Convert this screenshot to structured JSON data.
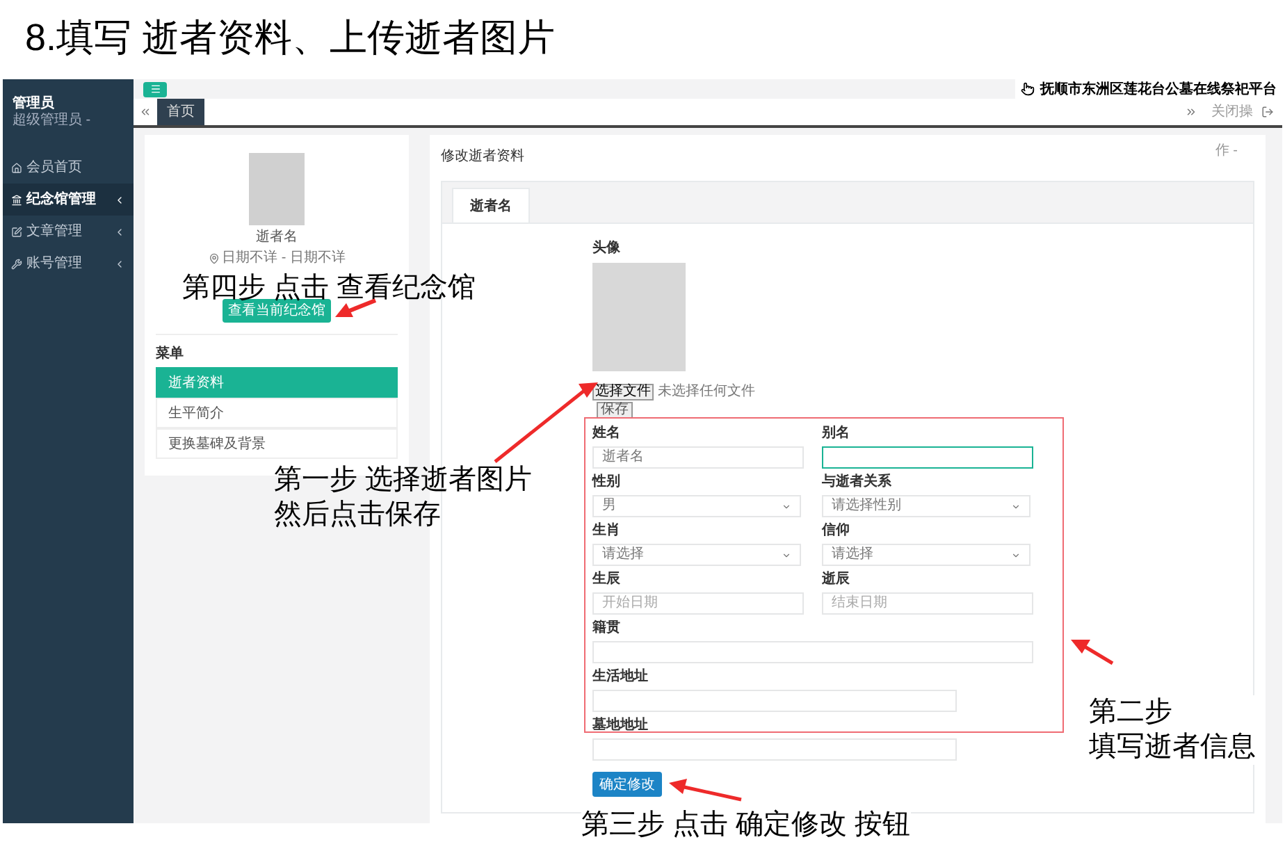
{
  "heading": "8.填写 逝者资料、上传逝者图片",
  "sidebar": {
    "user_name": "管理员",
    "user_role": "超级管理员 -",
    "items": [
      {
        "label": "会员首页",
        "selected": false,
        "has_children": false
      },
      {
        "label": "纪念馆管理",
        "selected": true,
        "has_children": true
      },
      {
        "label": "文章管理",
        "selected": false,
        "has_children": true
      },
      {
        "label": "账号管理",
        "selected": false,
        "has_children": true
      }
    ]
  },
  "topbar": {
    "site_title": "抚顺市东洲区莲花台公墓在线祭祀平台",
    "tabs": [
      {
        "label": "首页",
        "selected": true
      }
    ],
    "close_label": "关闭操"
  },
  "profile_card": {
    "name": "逝者名",
    "dates": "日期不详 - 日期不详",
    "view_button": "查看当前纪念馆",
    "menu_title": "菜单",
    "menu": [
      {
        "label": "逝者资料",
        "selected": true
      },
      {
        "label": "生平简介",
        "selected": false
      },
      {
        "label": "更换墓碑及背景",
        "selected": false
      }
    ]
  },
  "edit_panel": {
    "title": "修改逝者资料",
    "action_label": "作 -",
    "tabs": [
      {
        "label": "逝者名",
        "selected": true
      }
    ],
    "avatar_label": "头像",
    "file_button": "选择文件",
    "file_status": "未选择任何文件",
    "save_button": "保存",
    "fields": [
      {
        "kind": "text",
        "label": "姓名",
        "value": "逝者名",
        "focused": false
      },
      {
        "kind": "text",
        "label": "别名",
        "focused": true
      },
      {
        "kind": "select",
        "label": "性别",
        "value": "男",
        "focused": false
      },
      {
        "kind": "select",
        "label": "与逝者关系",
        "value": "请选择性别",
        "focused": false
      },
      {
        "kind": "select",
        "label": "生肖",
        "value": "请选择",
        "focused": false
      },
      {
        "kind": "select",
        "label": "信仰",
        "value": "请选择",
        "focused": false
      },
      {
        "kind": "date",
        "label": "生辰",
        "placeholder": "开始日期",
        "focused": false
      },
      {
        "kind": "date",
        "label": "逝辰",
        "placeholder": "结束日期",
        "focused": false
      },
      {
        "kind": "long_text",
        "label": "籍贯",
        "focused": false
      },
      {
        "kind": "long_text",
        "label": "生活地址",
        "focused": false
      },
      {
        "kind": "long_text",
        "label": "墓地地址",
        "focused": false
      }
    ],
    "submit_button": "确定修改"
  },
  "annotations": [
    {
      "lines": [
        "第四步 点击 查看纪念馆"
      ]
    },
    {
      "lines": [
        "第一步 选择逝者图片",
        "然后点击保存"
      ]
    },
    {
      "lines": [
        "第二步",
        "填写逝者信息"
      ]
    },
    {
      "lines": [
        "第三步 点击 确定修改 按钮"
      ]
    }
  ]
}
